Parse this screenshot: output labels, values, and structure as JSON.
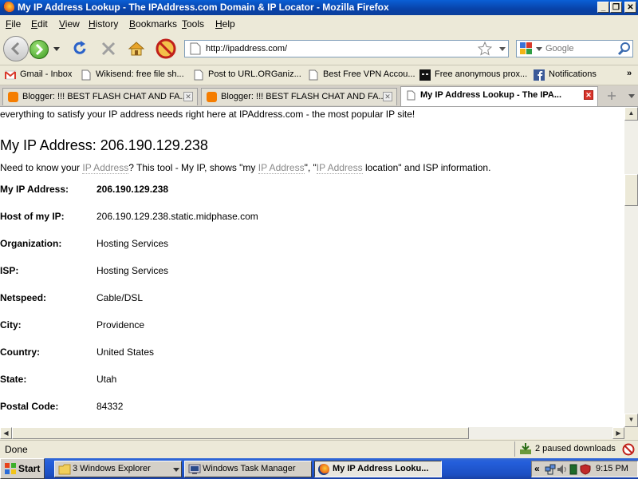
{
  "window": {
    "title": "My IP Address Lookup - The IPAddress.com Domain & IP Locator - Mozilla Firefox",
    "controls": {
      "minimize": "_",
      "maximize": "❐",
      "close": "✕"
    }
  },
  "menu": {
    "items": [
      {
        "mnemonic": "F",
        "rest": "ile"
      },
      {
        "mnemonic": "E",
        "rest": "dit"
      },
      {
        "mnemonic": "V",
        "rest": "iew"
      },
      {
        "mnemonic": "H",
        "rest": "istory"
      },
      {
        "mnemonic": "B",
        "rest": "ookmarks"
      },
      {
        "mnemonic": "T",
        "rest": "ools"
      },
      {
        "mnemonic": "H",
        "rest": "elp"
      }
    ]
  },
  "navigation": {
    "url": "http://ipaddress.com/",
    "search_placeholder": "Google"
  },
  "bookmarks": {
    "items": [
      "Gmail - Inbox",
      "Wikisend: free file sh...",
      "Post to URL.ORGaniz...",
      "Best Free VPN Accou...",
      "Free anonymous prox...",
      "Notifications"
    ],
    "overflow": "»"
  },
  "tabs": {
    "items": [
      "Blogger: !!! BEST FLASH CHAT AND FA...",
      "Blogger: !!! BEST FLASH CHAT AND FA...",
      "My IP Address Lookup - The IPA..."
    ],
    "active_index": 2
  },
  "page": {
    "intro": "everything to satisfy your IP address needs right here at IPAddress.com - the most popular IP site!",
    "heading": "My IP Address: 206.190.129.238",
    "desc_parts": [
      "Need to know your ",
      "IP Address",
      "? This tool - My IP, shows \"my ",
      "IP Address",
      "\", \"",
      "IP Address",
      " location\" and ISP information."
    ],
    "rows": [
      {
        "label": "My IP Address:",
        "value": "206.190.129.238",
        "bold": true
      },
      {
        "label": "Host of my IP:",
        "value": "206.190.129.238.static.midphase.com"
      },
      {
        "label": "Organization:",
        "value": "Hosting Services"
      },
      {
        "label": "ISP:",
        "value": "Hosting Services"
      },
      {
        "label": "Netspeed:",
        "value": "Cable/DSL"
      },
      {
        "label": "City:",
        "value": "Providence"
      },
      {
        "label": "Country:",
        "value": "United States"
      },
      {
        "label": "State:",
        "value": "Utah"
      },
      {
        "label": "Postal Code:",
        "value": "84332"
      }
    ]
  },
  "status": {
    "text": "Done",
    "downloads": "2 paused downloads"
  },
  "taskbar": {
    "start": "Start",
    "buttons": [
      "3 Windows Explorer",
      "Windows Task Manager",
      "My IP Address Looku..."
    ],
    "clock": "9:15 PM"
  },
  "colors": {
    "titlebar": "#0842a8",
    "taskbar": "#245edb",
    "link_gray": "#8a8a8a",
    "active_tab_close": "#d9342b"
  }
}
